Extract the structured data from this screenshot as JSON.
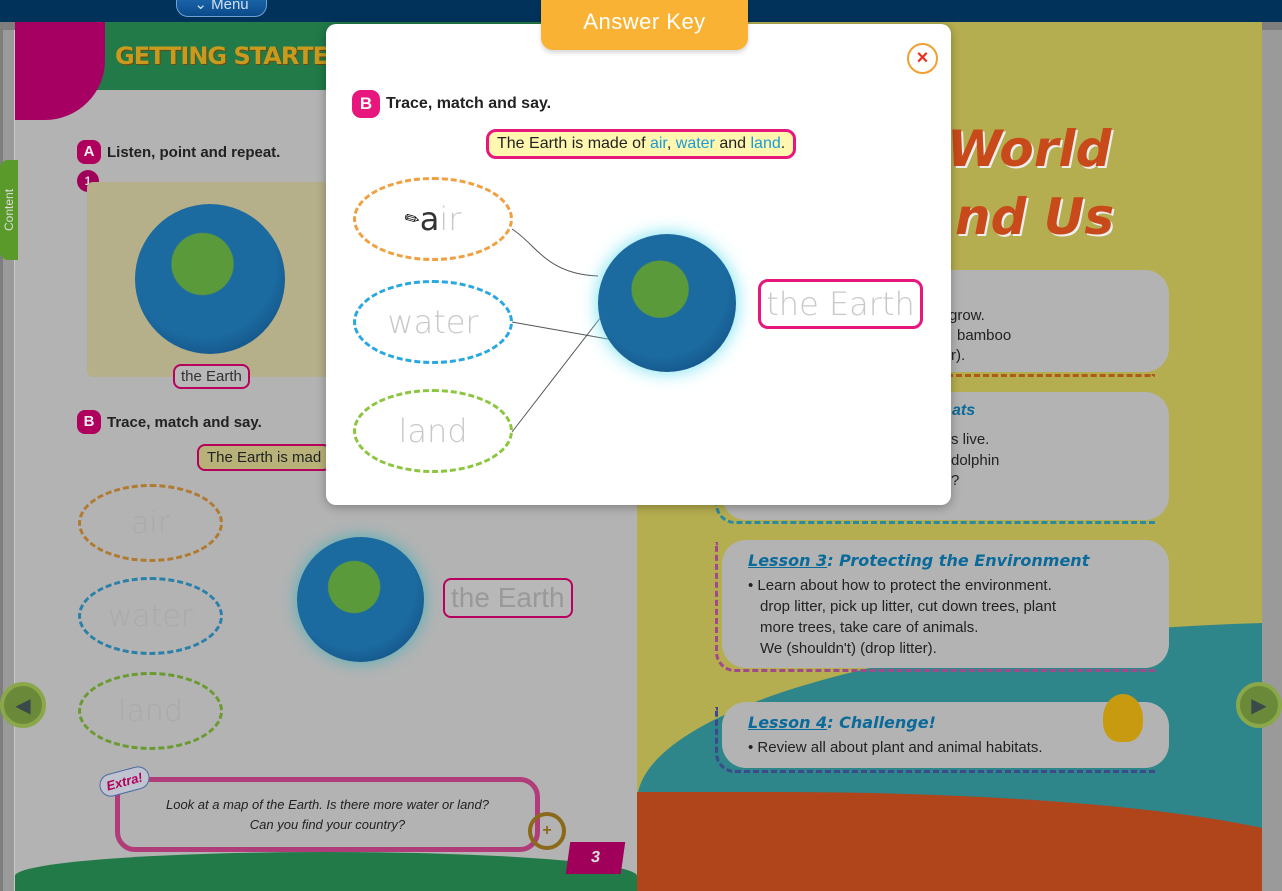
{
  "topbar": {
    "menu_label": "Menu"
  },
  "side_tab": {
    "label": "Content"
  },
  "left_page": {
    "header_title": "GETTING STARTED",
    "activity_a": {
      "badge": "A",
      "instruction": "Listen, point and repeat.",
      "item_number": "1",
      "card_label": "the Earth"
    },
    "activity_b": {
      "badge": "B",
      "instruction": "Trace, match and say.",
      "bubble_visible": "The Earth is mad",
      "words": [
        "air",
        "water",
        "land"
      ],
      "earth_label": "the Earth"
    },
    "extra": {
      "tag": "Extra!",
      "text_line1": "Look at a map of the Earth. Is there more water or land?",
      "text_line2": "Can you find your country?"
    },
    "page_number": "3"
  },
  "right_page": {
    "title_line1": "World",
    "title_line2": "nd Us",
    "lesson1_fragments": [
      "grow.",
      "bamboo",
      "r)."
    ],
    "lesson2_fragments": [
      "ats",
      "s live.",
      "dolphin",
      "?"
    ],
    "lesson3": {
      "title_prefix": "Lesson 3",
      "title_rest": ": Protecting the Environment",
      "lines": [
        "• Learn about how to protect the environment.",
        "drop litter, pick up litter, cut down trees, plant",
        "more trees, take care of animals.",
        "We (shouldn't) (drop litter)."
      ]
    },
    "lesson4": {
      "title_prefix": "Lesson 4",
      "title_rest": ": Challenge!",
      "lines": [
        "• Review all about plant and animal habitats."
      ]
    }
  },
  "modal": {
    "tab_title": "Answer Key",
    "close_icon": "×",
    "badge": "B",
    "instruction": "Trace, match and say.",
    "bubble": {
      "pre": "The Earth is made of ",
      "air": "air",
      "sep1": ", ",
      "water": "water",
      "sep2": " and ",
      "land": "land",
      "end": "."
    },
    "words": {
      "air_written": "a",
      "air_trace": "ir",
      "water": "water",
      "land": "land"
    },
    "earth_label": "the Earth",
    "colors": {
      "air": "#f0a040",
      "water": "#29a8e0",
      "land": "#8cc63f",
      "accent": "#e8177d",
      "tab": "#f9b233"
    }
  }
}
